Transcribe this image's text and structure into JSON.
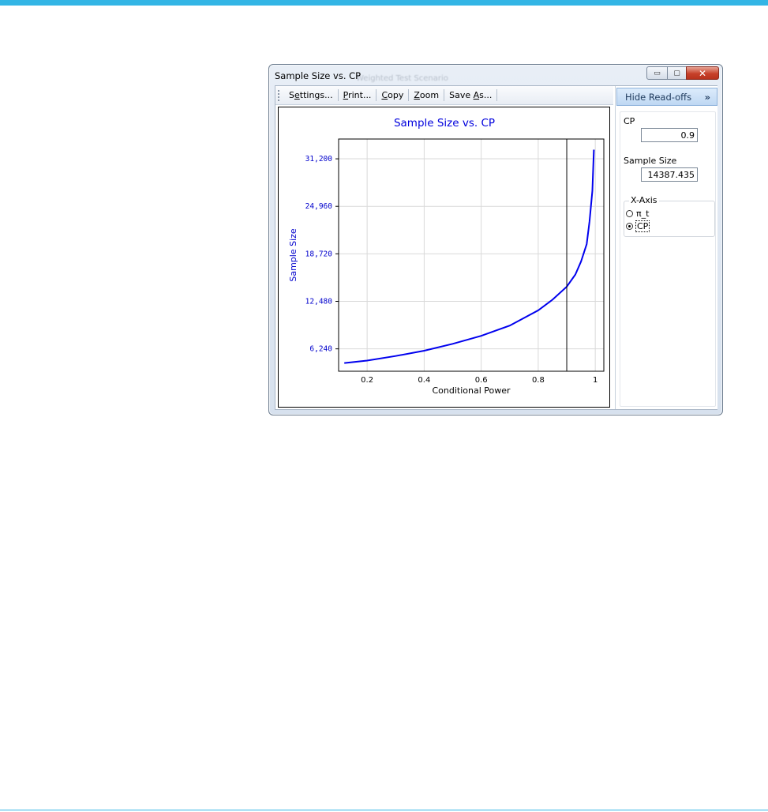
{
  "window": {
    "title": "Sample Size vs. CP",
    "background_title": "Weighted Test Scenario",
    "controls": {
      "minimize": "▭",
      "maximize": "▢",
      "close": "✕"
    }
  },
  "toolbar": {
    "items": [
      {
        "pre": "S",
        "u": "e",
        "post": "ttings..."
      },
      {
        "pre": "",
        "u": "P",
        "post": "rint..."
      },
      {
        "pre": "",
        "u": "C",
        "post": "opy"
      },
      {
        "pre": "",
        "u": "Z",
        "post": "oom"
      },
      {
        "pre": "Save ",
        "u": "A",
        "post": "s..."
      }
    ]
  },
  "side_panel": {
    "hide_label": "Hide Read-offs",
    "hide_chevron": "»",
    "cp_label": "CP",
    "cp_value": "0.9",
    "sample_size_label": "Sample Size",
    "sample_size_value": "14387.435",
    "xaxis_group_label": "X-Axis",
    "xaxis_options": [
      {
        "label": "π_t",
        "checked": false
      },
      {
        "label": "CP",
        "checked": true
      }
    ]
  },
  "chart_data": {
    "type": "line",
    "title": "Sample Size vs. CP",
    "xlabel": "Conditional Power",
    "ylabel": "Sample Size",
    "xlim": [
      0.1,
      1.03
    ],
    "ylim": [
      3300,
      33800
    ],
    "xticks": [
      0.2,
      0.4,
      0.6,
      0.8,
      1
    ],
    "xtick_labels": [
      "0.2",
      "0.4",
      "0.6",
      "0.8",
      "1"
    ],
    "yticks": [
      6240,
      12480,
      18720,
      24960,
      31200
    ],
    "ytick_labels": [
      "6,240",
      "12,480",
      "18,720",
      "24,960",
      "31,200"
    ],
    "grid": true,
    "marker_x": 0.9,
    "colors": {
      "line": "#0000ee",
      "title": "#0000dd",
      "axis_text": "#0000cc",
      "grid": "#d9d9d9"
    },
    "series": [
      {
        "x": [
          0.12,
          0.2,
          0.3,
          0.4,
          0.5,
          0.6,
          0.7,
          0.8,
          0.85,
          0.9,
          0.93,
          0.95,
          0.97,
          0.98,
          0.99,
          0.995
        ],
        "y": [
          4380,
          4700,
          5300,
          6000,
          6900,
          7950,
          9300,
          11300,
          12700,
          14400,
          16000,
          17700,
          20000,
          23000,
          27000,
          32400
        ]
      }
    ]
  }
}
